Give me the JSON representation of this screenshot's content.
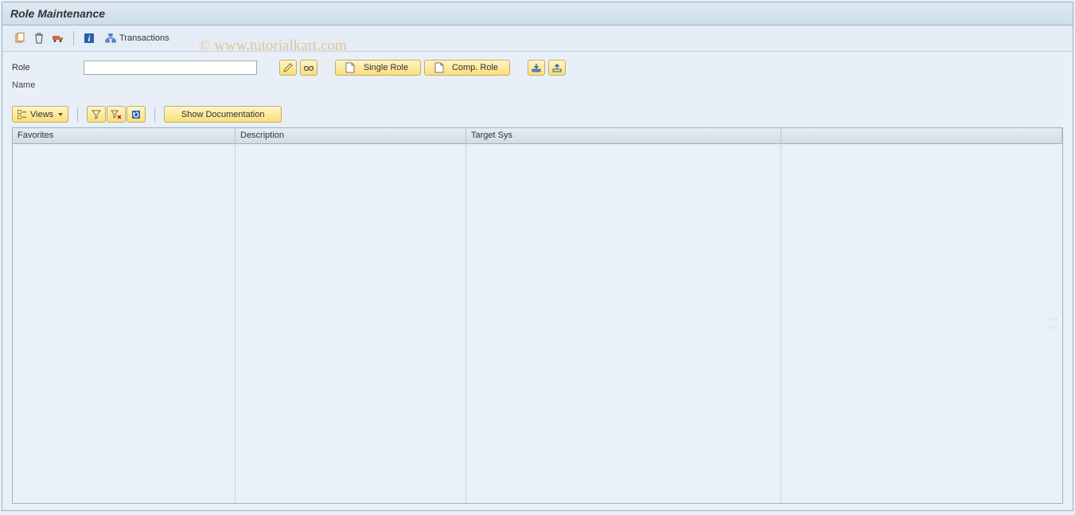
{
  "window": {
    "title": "Role Maintenance"
  },
  "toolbar": {
    "transactions_label": "Transactions"
  },
  "form": {
    "role_label": "Role",
    "role_value": "",
    "name_label": "Name",
    "single_role_label": "Single Role",
    "comp_role_label": "Comp. Role"
  },
  "sec_toolbar": {
    "views_label": "Views",
    "show_doc_label": "Show Documentation"
  },
  "grid": {
    "columns": {
      "favorites": "Favorites",
      "description": "Description",
      "target_sys": "Target Sys"
    }
  },
  "watermark": "© www.tutorialkart.com"
}
